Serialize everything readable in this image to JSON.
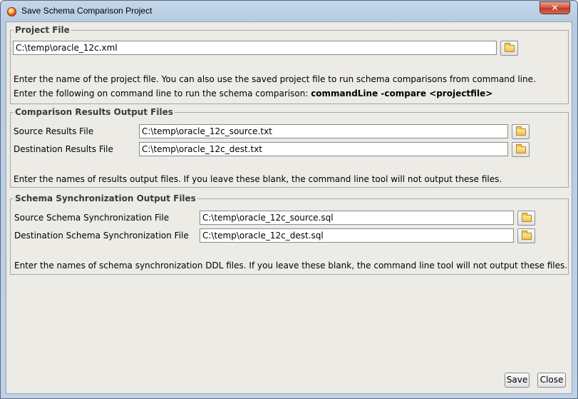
{
  "window": {
    "title": "Save Schema Comparison Project",
    "close_glyph": "✕"
  },
  "project_file": {
    "title": "Project File",
    "path": "C:\\temp\\oracle_12c.xml",
    "note_line1": "Enter the name of the project file. You can also use the saved project file to run schema comparisons from command line.",
    "note_line2_prefix": "Enter the following on command line to run the schema comparison: ",
    "note_line2_command": "commandLine -compare <projectfile>"
  },
  "results": {
    "title": "Comparison Results Output Files",
    "source_label": "Source Results File",
    "source_path": "C:\\temp\\oracle_12c_source.txt",
    "dest_label": "Destination Results File",
    "dest_path": "C:\\temp\\oracle_12c_dest.txt",
    "note": "Enter the names of results output files. If you leave these blank, the command line tool will not output these files."
  },
  "sync": {
    "title": "Schema Synchronization Output Files",
    "source_label": "Source Schema Synchronization File",
    "source_path": "C:\\temp\\oracle_12c_source.sql",
    "dest_label": "Destination Schema Synchronization File",
    "dest_path": "C:\\temp\\oracle_12c_dest.sql",
    "note": "Enter the names of schema synchronization DDL files. If you leave these blank, the command line tool will not output these files."
  },
  "buttons": {
    "save": "Save",
    "close": "Close"
  }
}
